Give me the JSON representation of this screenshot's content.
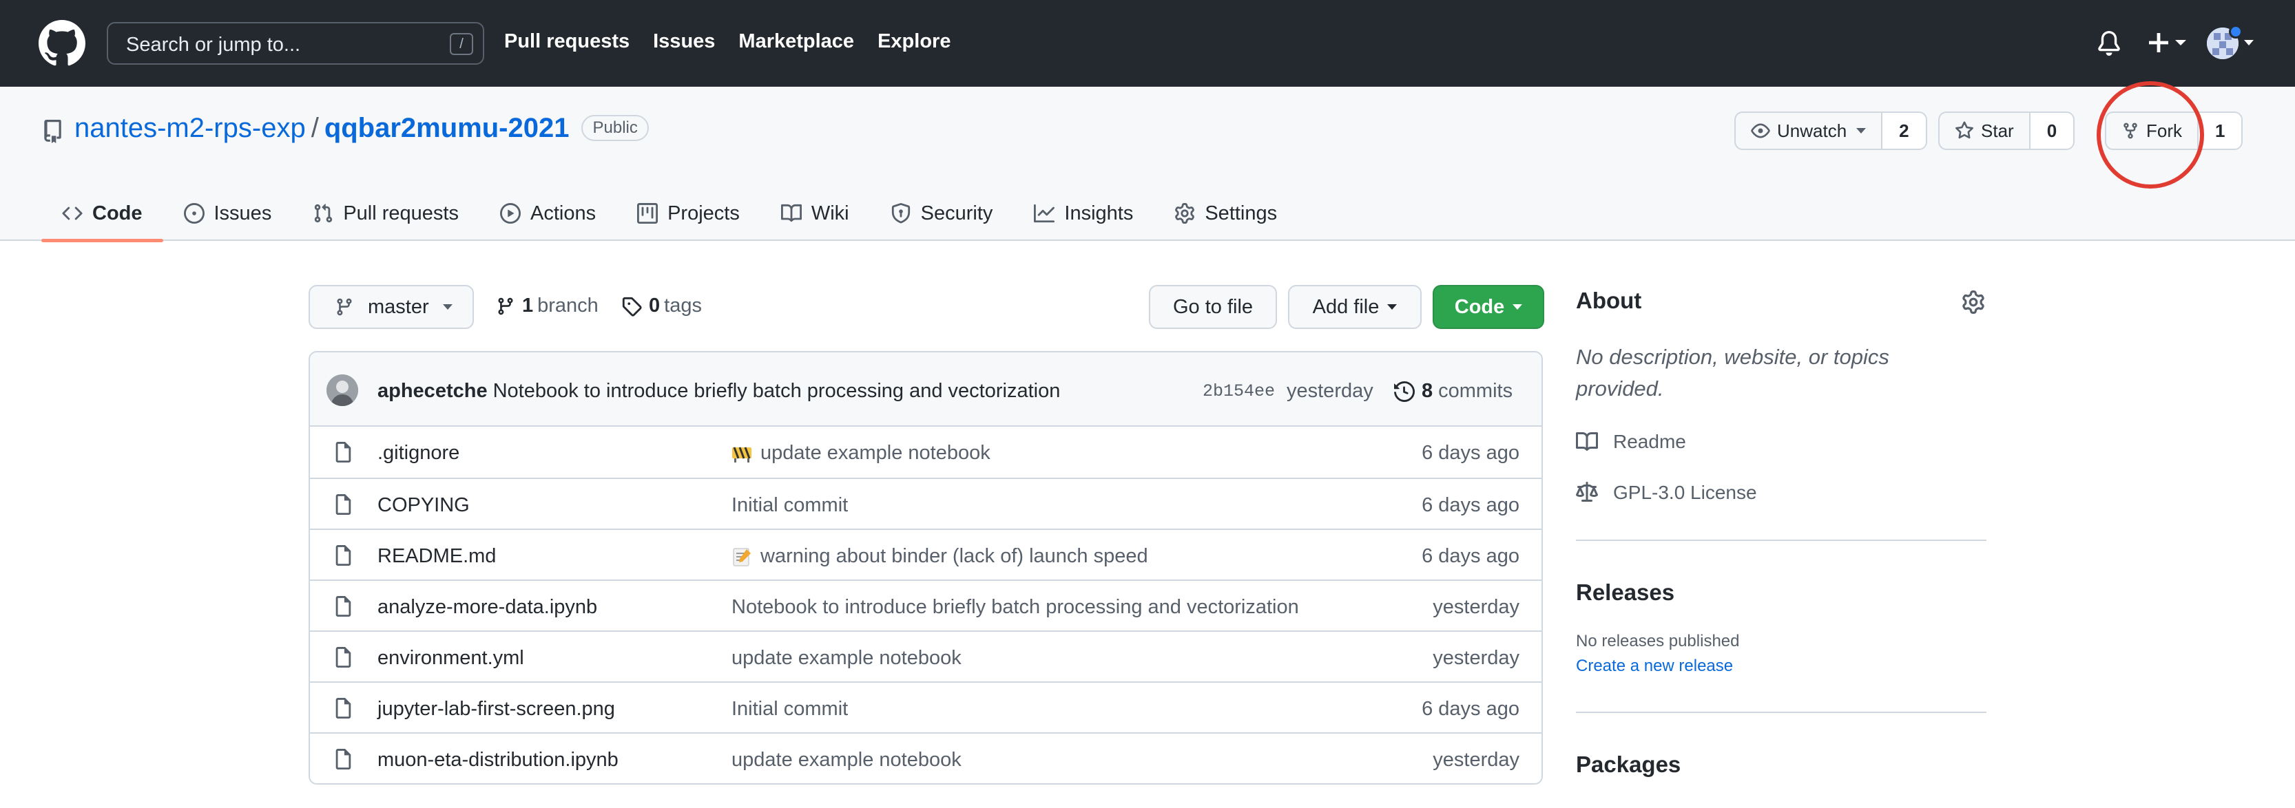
{
  "header": {
    "search_placeholder": "Search or jump to...",
    "search_shortcut": "/",
    "nav": [
      "Pull requests",
      "Issues",
      "Marketplace",
      "Explore"
    ]
  },
  "repo": {
    "owner": "nantes-m2-rps-exp",
    "separator": "/",
    "name": "qqbar2mumu-2021",
    "visibility": "Public",
    "watch_label": "Unwatch",
    "watch_count": "2",
    "star_label": "Star",
    "star_count": "0",
    "fork_label": "Fork",
    "fork_count": "1"
  },
  "tabs": [
    {
      "label": "Code",
      "icon": "code-icon",
      "active": true
    },
    {
      "label": "Issues",
      "icon": "issue-icon"
    },
    {
      "label": "Pull requests",
      "icon": "pull-request-icon"
    },
    {
      "label": "Actions",
      "icon": "play-icon"
    },
    {
      "label": "Projects",
      "icon": "project-icon"
    },
    {
      "label": "Wiki",
      "icon": "book-icon"
    },
    {
      "label": "Security",
      "icon": "shield-icon"
    },
    {
      "label": "Insights",
      "icon": "graph-icon"
    },
    {
      "label": "Settings",
      "icon": "gear-icon"
    }
  ],
  "toolbar": {
    "branch": "master",
    "branch_count": "1",
    "branch_label": "branch",
    "tag_count": "0",
    "tag_label": "tags",
    "goto_file": "Go to file",
    "add_file": "Add file",
    "code": "Code"
  },
  "commit": {
    "author": "aphecetche",
    "message": "Notebook to introduce briefly batch processing and vectorization",
    "sha": "2b154ee",
    "when": "yesterday",
    "count": "8",
    "count_label": "commits"
  },
  "files": [
    {
      "name": ".gitignore",
      "message": "update example notebook",
      "emoji": "construction-emoji",
      "age": "6 days ago"
    },
    {
      "name": "COPYING",
      "message": "Initial commit",
      "age": "6 days ago"
    },
    {
      "name": "README.md",
      "message": "warning about binder (lack of) launch speed",
      "emoji": "memo-emoji",
      "age": "6 days ago"
    },
    {
      "name": "analyze-more-data.ipynb",
      "message": "Notebook to introduce briefly batch processing and vectorization",
      "age": "yesterday"
    },
    {
      "name": "environment.yml",
      "message": "update example notebook",
      "age": "yesterday"
    },
    {
      "name": "jupyter-lab-first-screen.png",
      "message": "Initial commit",
      "age": "6 days ago"
    },
    {
      "name": "muon-eta-distribution.ipynb",
      "message": "update example notebook",
      "age": "yesterday"
    }
  ],
  "sidebar": {
    "about_title": "About",
    "about_desc": "No description, website, or topics provided.",
    "readme": "Readme",
    "license": "GPL-3.0 License",
    "releases_title": "Releases",
    "no_releases": "No releases published",
    "create_release": "Create a new release",
    "packages_title": "Packages"
  },
  "colors": {
    "header_bg": "#24292f",
    "link": "#0969da",
    "green_button": "#2da44e",
    "active_tab_underline": "#fd8c73",
    "highlight_circle": "#e03c31"
  }
}
